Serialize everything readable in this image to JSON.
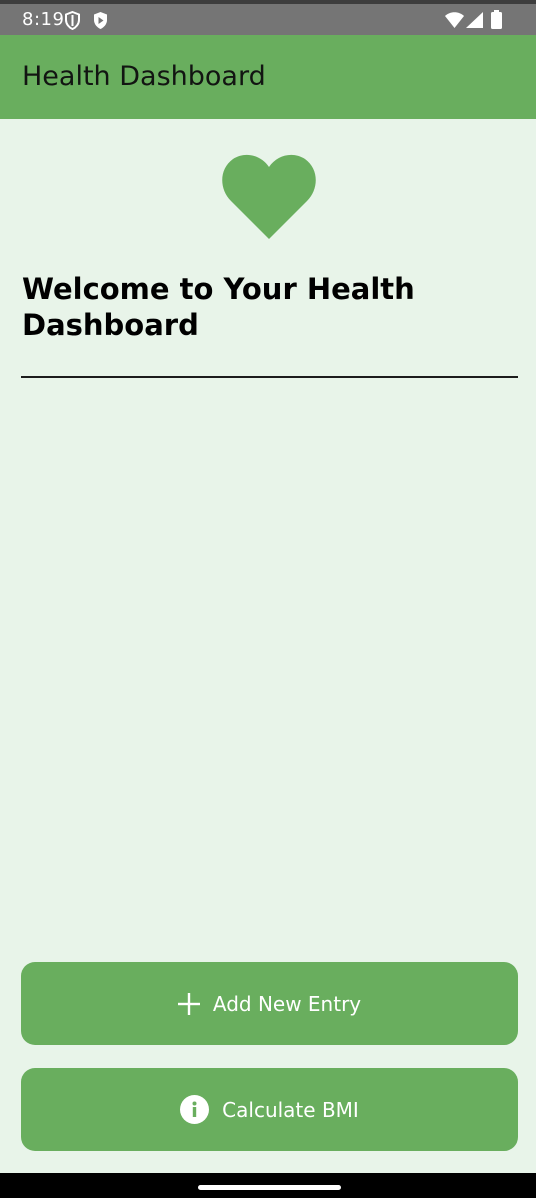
{
  "status_bar": {
    "time": "8:19",
    "left_icons": [
      "shield-icon",
      "play-protect-icon"
    ],
    "right_icons": [
      "wifi-icon",
      "cell-signal-icon",
      "battery-icon"
    ]
  },
  "app_bar": {
    "title": "Health Dashboard",
    "background": "#69ae5e"
  },
  "main": {
    "hero_icon": "heart-icon",
    "welcome_text": "Welcome to Your Health Dashboard",
    "background": "#e8f4e9"
  },
  "actions": {
    "add_entry": {
      "label": "Add New Entry",
      "icon": "plus-icon"
    },
    "calculate_bmi": {
      "label": "Calculate BMI",
      "icon": "info-icon"
    }
  },
  "colors": {
    "accent": "#69ae5e",
    "status_bar": "#757575",
    "text": "#000000"
  }
}
